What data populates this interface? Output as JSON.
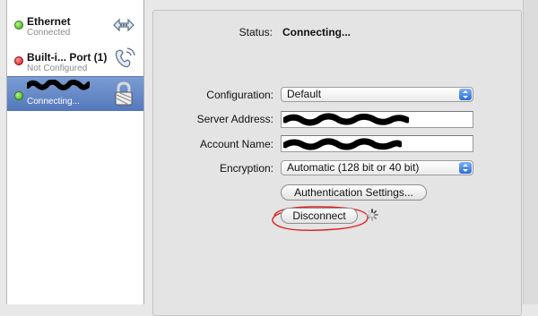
{
  "services": [
    {
      "name": "Ethernet",
      "status": "Connected",
      "dot": "green",
      "icon": "ethernet-arrows-icon"
    },
    {
      "name": "Built-i... Port (1)",
      "status": "Not Configured",
      "dot": "red",
      "icon": "phone-modem-icon"
    },
    {
      "name": "",
      "status": "Connecting...",
      "dot": "green",
      "icon": "lock-icon",
      "selected": true
    }
  ],
  "status": {
    "label": "Status:",
    "value": "Connecting..."
  },
  "form": {
    "configuration": {
      "label": "Configuration:",
      "value": "Default"
    },
    "server_address": {
      "label": "Server Address:",
      "value": ""
    },
    "account_name": {
      "label": "Account Name:",
      "value": ""
    },
    "encryption": {
      "label": "Encryption:",
      "value": "Automatic (128 bit or 40 bit)"
    }
  },
  "buttons": {
    "auth_settings": "Authentication Settings...",
    "disconnect": "Disconnect"
  },
  "colors": {
    "selection": "#5f82c2",
    "accent_popup": "#2a6fd6",
    "annotation": "#e02222"
  }
}
